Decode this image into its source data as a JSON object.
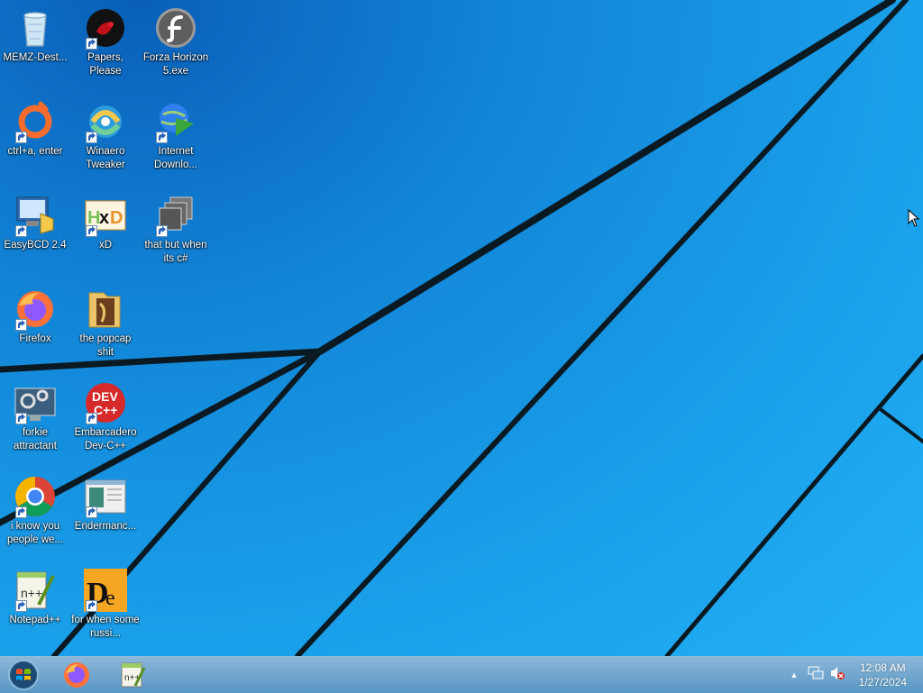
{
  "desktop": {
    "icons": [
      {
        "label": "MEMZ-Dest...",
        "icon": "recycle-bin-icon",
        "shortcut": false
      },
      {
        "label": "Papers, Please",
        "icon": "papers-please-icon",
        "shortcut": true
      },
      {
        "label": "Forza Horizon 5.exe",
        "icon": "flash-player-icon",
        "shortcut": false
      },
      {
        "label": "ctrl+a, enter",
        "icon": "origin-icon",
        "shortcut": true
      },
      {
        "label": "Winaero Tweaker",
        "icon": "winaero-tweaker-icon",
        "shortcut": true
      },
      {
        "label": "Internet Downlo...",
        "icon": "internet-download-manager-icon",
        "shortcut": true
      },
      {
        "label": "EasyBCD 2.4",
        "icon": "easybcd-icon",
        "shortcut": true
      },
      {
        "label": "xD",
        "icon": "hxd-icon",
        "shortcut": true
      },
      {
        "label": "that but when its c#",
        "icon": "windows-stack-icon",
        "shortcut": true
      },
      {
        "label": "Firefox",
        "icon": "firefox-icon",
        "shortcut": true
      },
      {
        "label": "the popcap shit",
        "icon": "folder-icon",
        "shortcut": false
      },
      {
        "label": "forkie attractant",
        "icon": "computer-settings-icon",
        "shortcut": true
      },
      {
        "label": "Embarcadero Dev-C++",
        "icon": "devcpp-icon",
        "shortcut": true
      },
      {
        "label": "i know you people we...",
        "icon": "chrome-icon",
        "shortcut": true
      },
      {
        "label": "Endermanc...",
        "icon": "document-window-icon",
        "shortcut": true
      },
      {
        "label": "Notepad++",
        "icon": "notepadpp-icon",
        "shortcut": true
      },
      {
        "label": "for when some russi...",
        "icon": "dependency-walker-icon",
        "shortcut": true
      }
    ]
  },
  "taskbar": {
    "start": "windows-start-orb-icon",
    "pinned": [
      "firefox-icon",
      "notepadpp-icon"
    ],
    "tray": {
      "icons": [
        "show-hidden-icons-arrow",
        "network-icon",
        "volume-muted-icon"
      ],
      "time": "12:08 AM",
      "date": "1/27/2024"
    }
  },
  "colors": {
    "accent": "#1aa0ea",
    "taskbar": "#5a9ccc"
  }
}
